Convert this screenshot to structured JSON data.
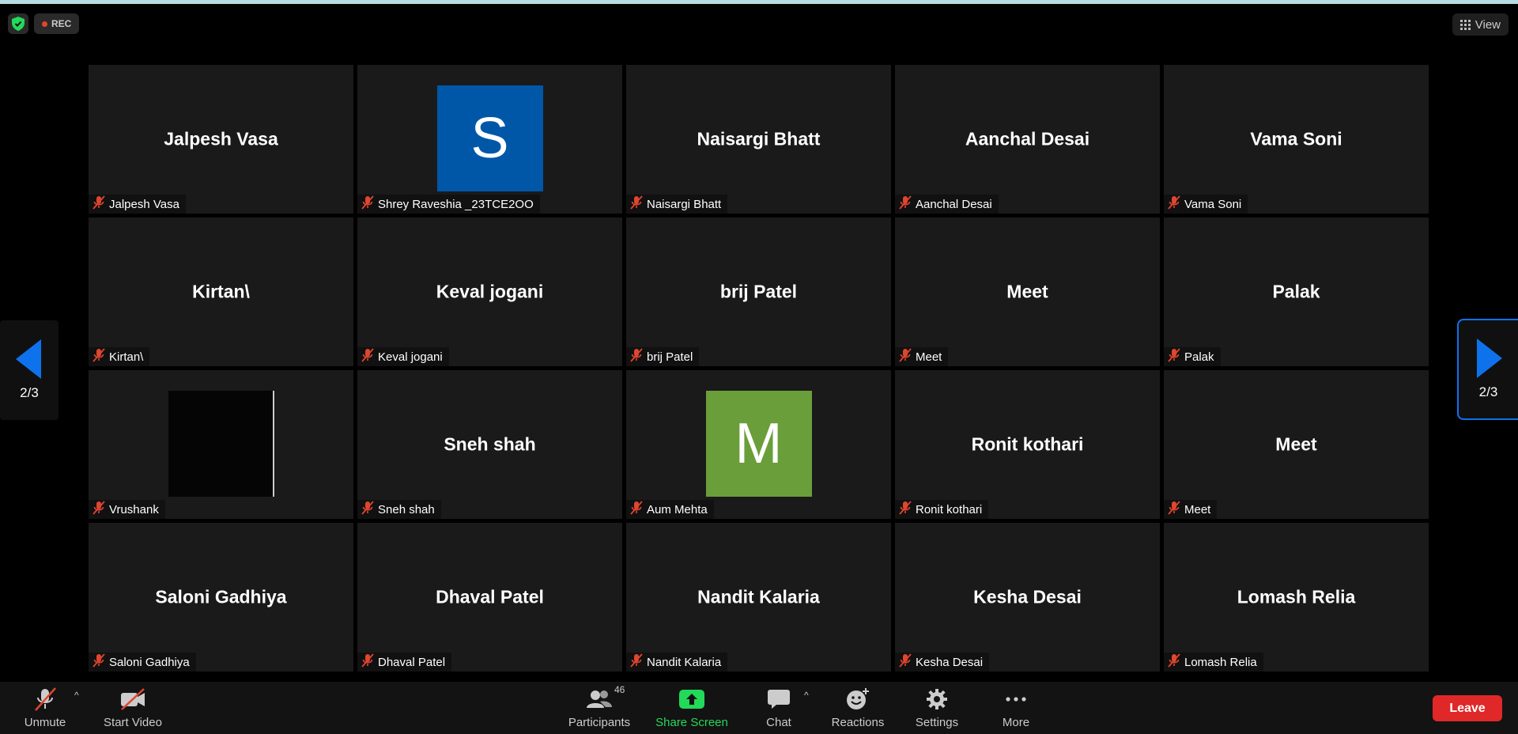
{
  "top_bar": {
    "rec_label": "REC",
    "view_label": "View"
  },
  "pager": {
    "left_page": "2/3",
    "right_page": "2/3"
  },
  "tiles": [
    {
      "big_name": "Jalpesh Vasa",
      "label": "Jalpesh Vasa"
    },
    {
      "avatar_letter": "S",
      "avatar_color": "#0057a8",
      "label": "Shrey Raveshia _23TCE2OO"
    },
    {
      "big_name": "Naisargi Bhatt",
      "label": "Naisargi Bhatt"
    },
    {
      "big_name": "Aanchal Desai",
      "label": "Aanchal Desai"
    },
    {
      "big_name": "Vama Soni",
      "label": "Vama Soni"
    },
    {
      "big_name": "Kirtan\\",
      "label": "Kirtan\\"
    },
    {
      "big_name": "Keval jogani",
      "label": "Keval jogani"
    },
    {
      "big_name": "brij Patel",
      "label": "brij Patel"
    },
    {
      "big_name": "Meet",
      "label": "Meet"
    },
    {
      "big_name": "Palak",
      "label": "Palak"
    },
    {
      "label": "Vrushank"
    },
    {
      "big_name": "Sneh shah",
      "label": "Sneh shah"
    },
    {
      "avatar_letter": "M",
      "avatar_color": "#6a9e3a",
      "label": "Aum Mehta"
    },
    {
      "big_name": "Ronit kothari",
      "label": "Ronit kothari"
    },
    {
      "big_name": "Meet",
      "label": "Meet"
    },
    {
      "big_name": "Saloni Gadhiya",
      "label": "Saloni Gadhiya"
    },
    {
      "big_name": "Dhaval Patel",
      "label": "Dhaval Patel"
    },
    {
      "big_name": "Nandit Kalaria",
      "label": "Nandit Kalaria"
    },
    {
      "big_name": "Kesha Desai",
      "label": "Kesha Desai"
    },
    {
      "big_name": "Lomash Relia",
      "label": "Lomash Relia"
    }
  ],
  "toolbar": {
    "unmute": "Unmute",
    "start_video": "Start Video",
    "participants": "Participants",
    "participant_count": "46",
    "share_screen": "Share Screen",
    "chat": "Chat",
    "reactions": "Reactions",
    "settings": "Settings",
    "more": "More",
    "leave": "Leave"
  },
  "colors": {
    "share_green": "#23d959",
    "leave_red": "#e02828",
    "mute_red": "#e0452f",
    "accent_blue": "#0e72ed"
  }
}
